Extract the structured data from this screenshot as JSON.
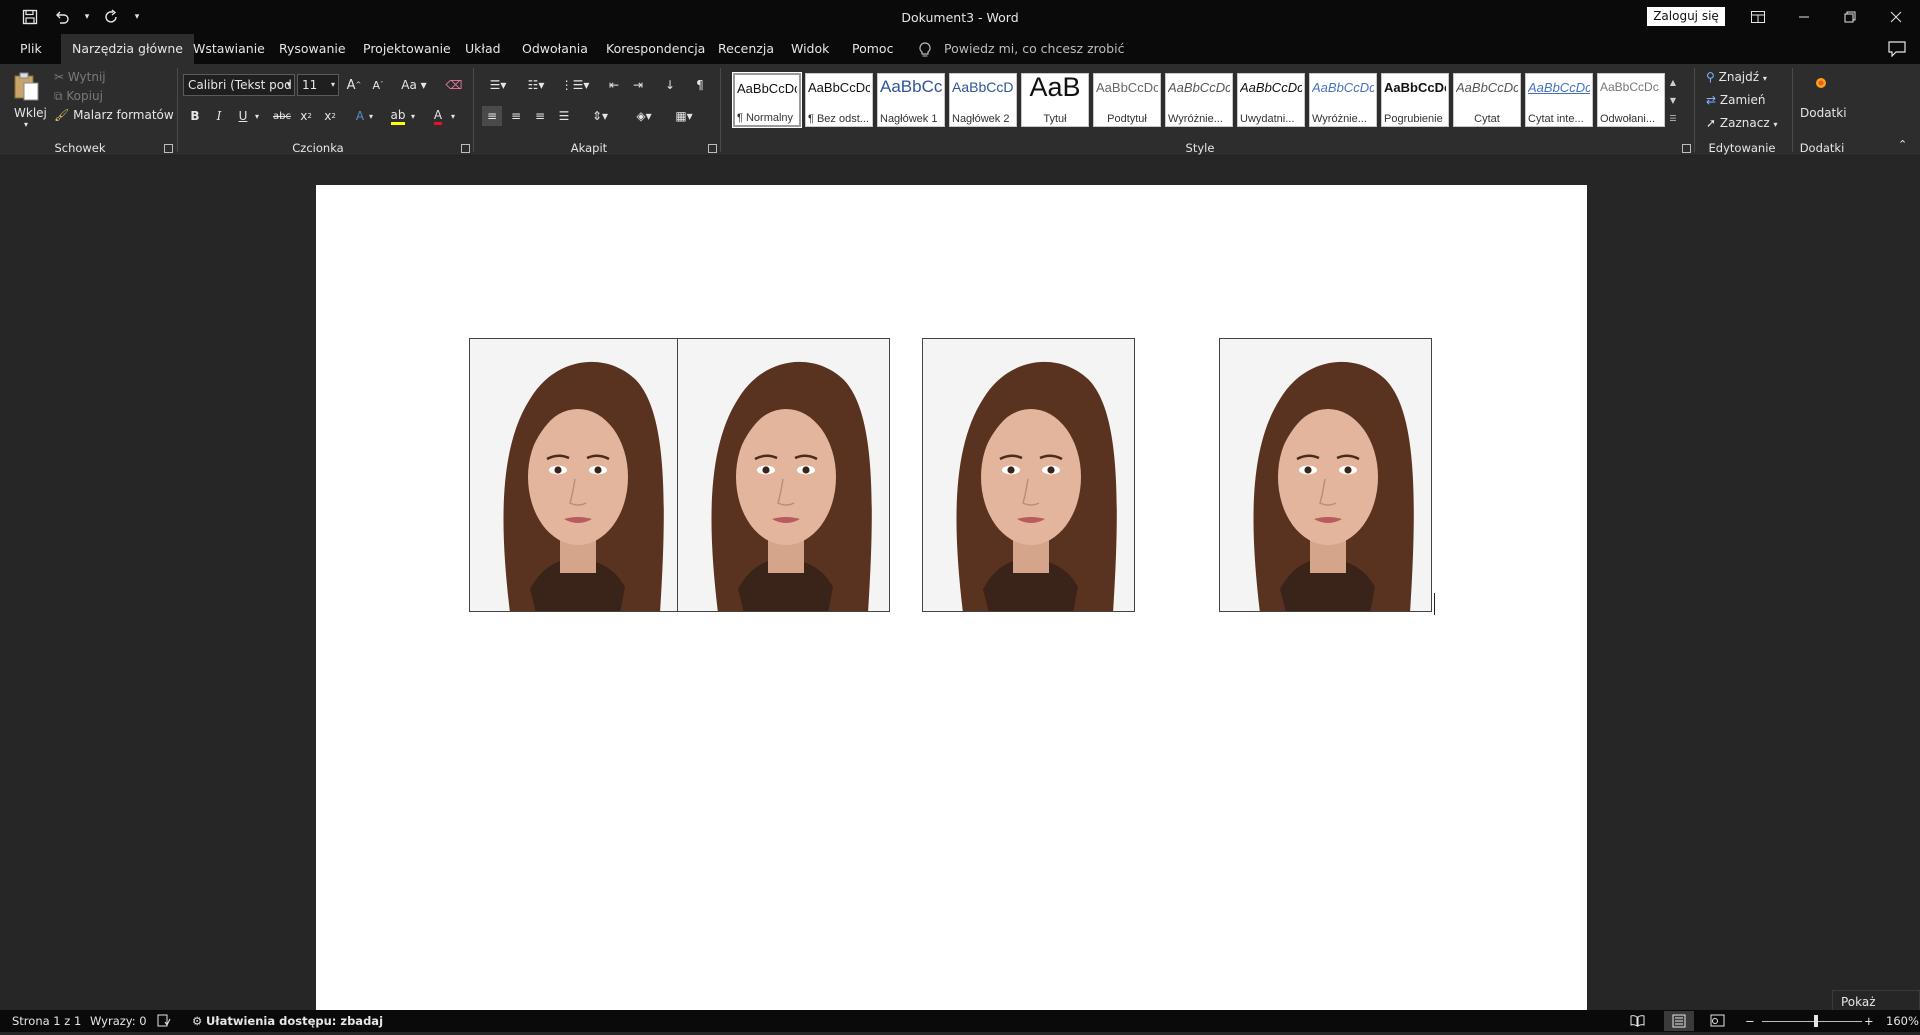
{
  "window": {
    "title": "Dokument3  -  Word",
    "login_label": "Zaloguj się"
  },
  "tabs": [
    {
      "label": "Plik"
    },
    {
      "label": "Narzędzia główne",
      "active": true
    },
    {
      "label": "Wstawianie"
    },
    {
      "label": "Rysowanie"
    },
    {
      "label": "Projektowanie"
    },
    {
      "label": "Układ"
    },
    {
      "label": "Odwołania"
    },
    {
      "label": "Korespondencja"
    },
    {
      "label": "Recenzja"
    },
    {
      "label": "Widok"
    },
    {
      "label": "Pomoc"
    }
  ],
  "tell_me": "Powiedz mi, co chcesz zrobić",
  "clipboard": {
    "paste_label": "Wklej",
    "cut_label": "Wytnij",
    "copy_label": "Kopiuj",
    "format_painter_label": "Malarz formatów",
    "group_label": "Schowek"
  },
  "font": {
    "name": "Calibri (Tekst pod",
    "size": "11",
    "group_label": "Czcionka"
  },
  "paragraph": {
    "group_label": "Akapit"
  },
  "styles": {
    "items": [
      {
        "sample": "AaBbCcDc",
        "name": "¶ Normalny"
      },
      {
        "sample": "AaBbCcDc",
        "name": "¶ Bez odst..."
      },
      {
        "sample": "AaBbCc",
        "name": "Nagłówek 1"
      },
      {
        "sample": "AaBbCcD",
        "name": "Nagłówek 2"
      },
      {
        "sample": "AaB",
        "name": "Tytuł"
      },
      {
        "sample": "AaBbCcDc",
        "name": "Podtytuł"
      },
      {
        "sample": "AaBbCcDc",
        "name": "Wyróżnie..."
      },
      {
        "sample": "AaBbCcDc",
        "name": "Uwydatni..."
      },
      {
        "sample": "AaBbCcDc",
        "name": "Wyróżnie..."
      },
      {
        "sample": "AaBbCcDc",
        "name": "Pogrubienie"
      },
      {
        "sample": "AaBbCcDc",
        "name": "Cytat"
      },
      {
        "sample": "AaBbCcDc",
        "name": "Cytat inte..."
      },
      {
        "sample": "AaBbCcDc",
        "name": "Odwołani..."
      }
    ],
    "group_label": "Style"
  },
  "editing": {
    "find_label": "Znajdź",
    "replace_label": "Zamień",
    "select_label": "Zaznacz",
    "group_label": "Edytowanie"
  },
  "addins": {
    "button_label": "Dodatki",
    "group_label": "Dodatki"
  },
  "status": {
    "page": "Strona 1 z 1",
    "words": "Wyrazy: 0",
    "accessibility": "Ułatwienia dostępu: zbadaj",
    "zoom": "160%"
  },
  "tooltip": "Pokaż pulpit",
  "colors": {
    "title_bg": "#0a0a0a",
    "ribbon_bg": "#2d2d2d",
    "canvas_bg": "#262626",
    "font_color_red": "#e81123",
    "highlight_yellow": "#ffff00",
    "addins_orange": "#f7a21b"
  }
}
